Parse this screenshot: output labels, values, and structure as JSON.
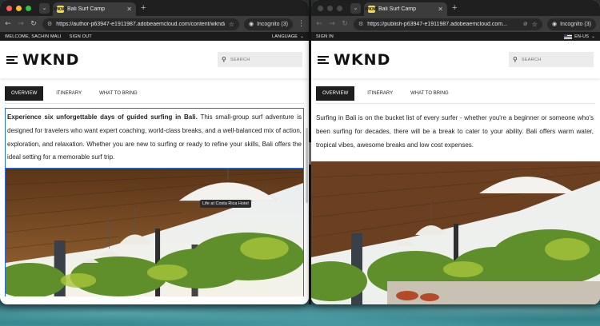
{
  "left_window": {
    "tab": {
      "favicon_text": "WKND",
      "title": "Bali Surf Camp"
    },
    "url": "https://author-p63947-e1911987.adobeaemcloud.com/content/wknd/...",
    "incognito_label": "Incognito (3)",
    "utility_bar": {
      "welcome": "WELCOME, SACHIN MALI",
      "sign_out": "SIGN OUT",
      "language": "LANGUAGE"
    },
    "logo": "WKND",
    "search_placeholder": "SEARCH",
    "tabs": [
      "OVERVIEW",
      "ITINERARY",
      "WHAT TO BRING"
    ],
    "intro_bold": "Experience six unforgettable days of guided surfing in Bali.",
    "intro_rest": " This small-group surf adventure is designed for travelers who want expert coaching, world-class breaks, and a well-balanced mix of action, exploration, and relaxation. Whether you are new to surfing or ready to refine your skills, Bali offers the ideal setting for a memorable surf trip.",
    "image_tooltip": "Life at Costa Rica Hotel"
  },
  "right_window": {
    "tab": {
      "favicon_text": "WKND",
      "title": "Bali Surf Camp"
    },
    "url": "https://publish-p63947-e1911987.adobeaemcloud.com...",
    "incognito_label": "Incognito (3)",
    "utility_bar": {
      "sign_in": "SIGN IN",
      "language": "EN-US"
    },
    "logo": "WKND",
    "search_placeholder": "SEARCH",
    "tabs": [
      "OVERVIEW",
      "ITINERARY",
      "WHAT TO BRING"
    ],
    "intro": "Surfing in Bali is on the bucket list of every surfer - whether you're a beginner or someone who's been surfing for decades, there will be a break to cater to your ability. Bali offers warm water, tropical vibes, awesome breaks and low cost expenses."
  },
  "icons": [
    "back-icon",
    "forward-icon",
    "reload-icon",
    "site-info-icon",
    "bookmark-star-icon",
    "incognito-icon",
    "more-icon",
    "search-icon",
    "hamburger-icon",
    "flag-icon",
    "eye-off-icon"
  ],
  "colors": {
    "chrome_dark": "#1f1f1f",
    "chrome_toolbar": "#3c3c3c",
    "author_selection": "#2f6bd8",
    "active_tab": "#1e1e1e"
  }
}
